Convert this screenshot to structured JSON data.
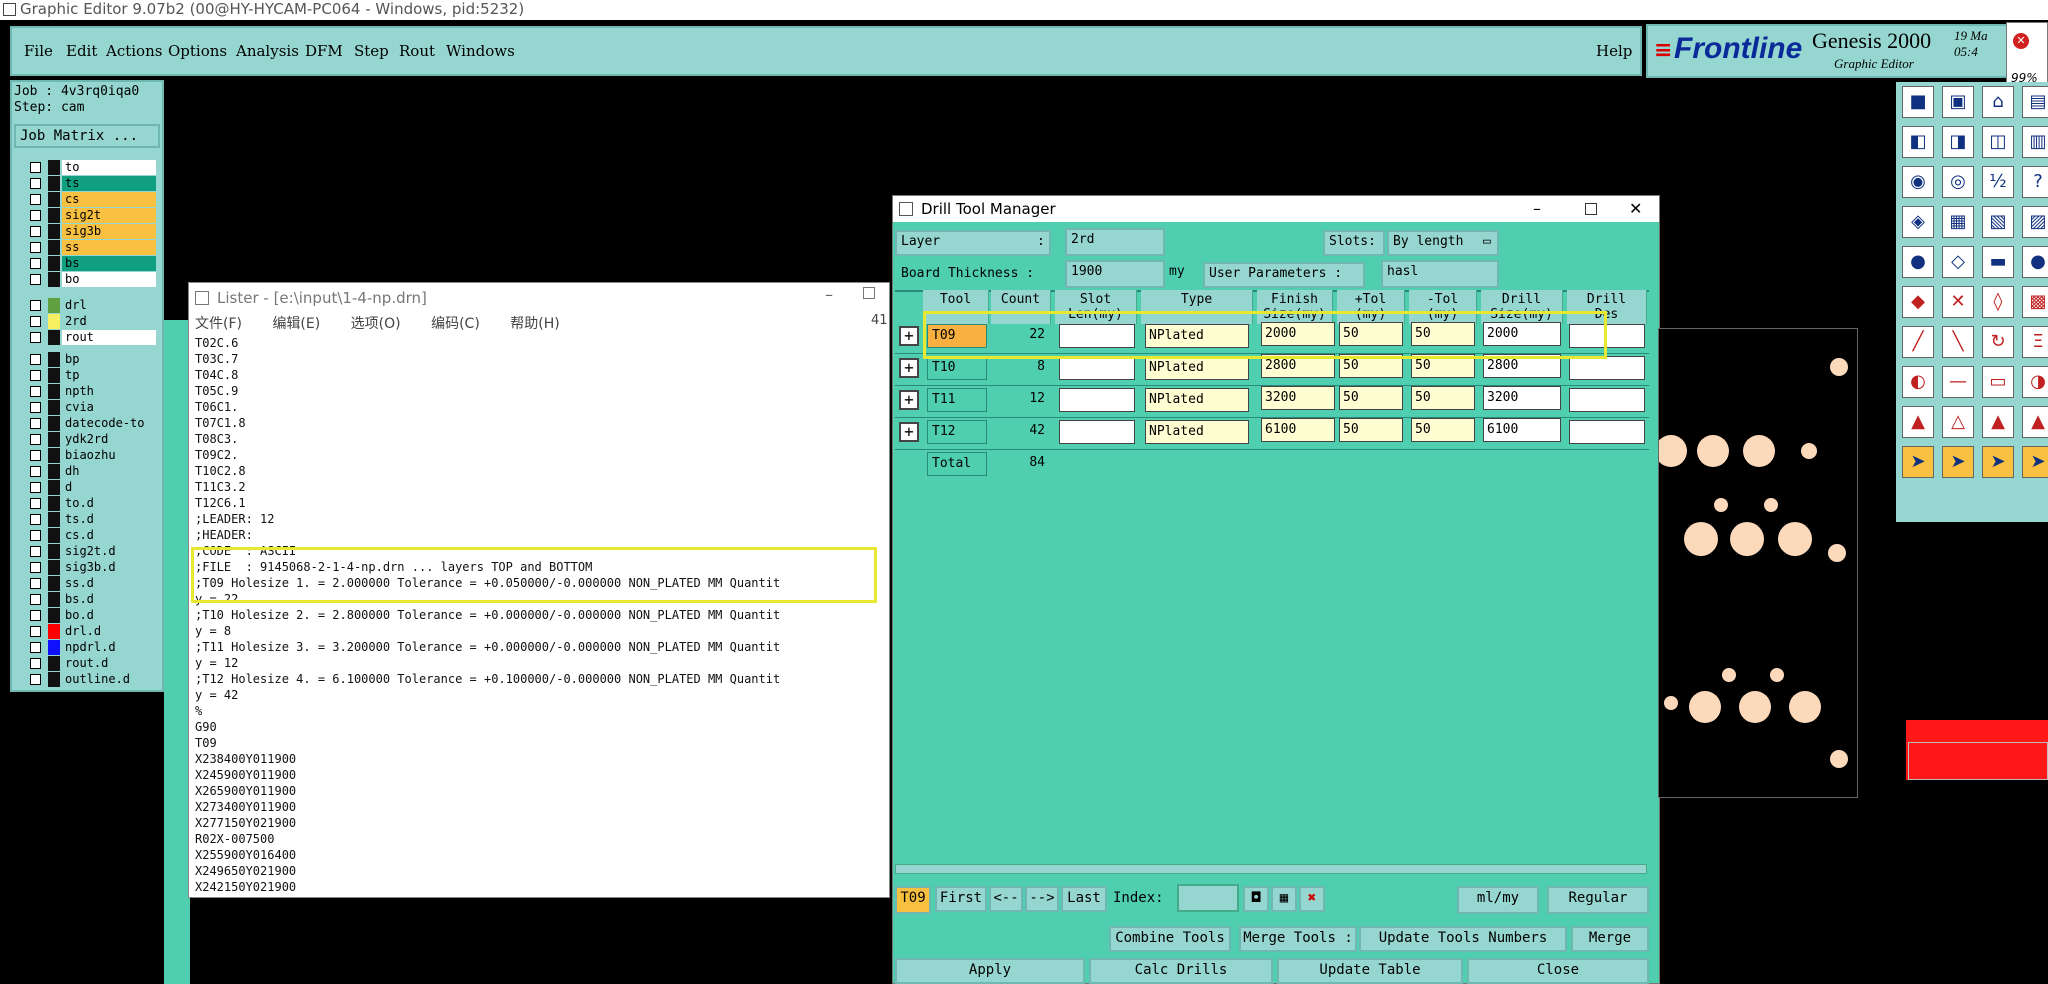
{
  "window": {
    "title": "Graphic Editor 9.07b2 (00@HY-HYCAM-PC064 - Windows, pid:5232)"
  },
  "menu": {
    "items": [
      "File",
      "Edit",
      "Actions",
      "Options",
      "Analysis",
      "DFM",
      "Step",
      "Rout",
      "Windows"
    ],
    "help": "Help"
  },
  "brand": {
    "logo": "Frontline",
    "product": "Genesis 2000",
    "subtitle": "Graphic Editor",
    "date": "19 Ma",
    "time": "05:4",
    "percent": "99%"
  },
  "job": {
    "job_label": "Job : 4v3rq0iqa0",
    "step_label": "Step: cam",
    "matrix_button": "Job Matrix ..."
  },
  "layers": [
    {
      "name": "to",
      "bg": "#ffffff"
    },
    {
      "name": "ts",
      "bg": "#10a080"
    },
    {
      "name": "cs",
      "bg": "#f8c040"
    },
    {
      "name": "sig2t",
      "bg": "#f8c040"
    },
    {
      "name": "sig3b",
      "bg": "#f8c040"
    },
    {
      "name": "ss",
      "bg": "#f8c040"
    },
    {
      "name": "bs",
      "bg": "#10a080"
    },
    {
      "name": "bo",
      "bg": "#ffffff"
    },
    {
      "name": "drl",
      "bg": "#96d6d0",
      "swatch": "#60a040"
    },
    {
      "name": "2rd",
      "bg": "#96d6d0",
      "swatch": "#f8f060"
    },
    {
      "name": "rout",
      "bg": "#ffffff"
    },
    {
      "name": "bp",
      "bg": "#96d6d0"
    },
    {
      "name": "tp",
      "bg": "#96d6d0"
    },
    {
      "name": "npth",
      "bg": "#96d6d0"
    },
    {
      "name": "cvia",
      "bg": "#96d6d0"
    },
    {
      "name": "datecode-to",
      "bg": "#96d6d0"
    },
    {
      "name": "ydk2rd",
      "bg": "#96d6d0"
    },
    {
      "name": "biaozhu",
      "bg": "#96d6d0"
    },
    {
      "name": "dh",
      "bg": "#96d6d0"
    },
    {
      "name": "d",
      "bg": "#96d6d0"
    },
    {
      "name": "to.d",
      "bg": "#96d6d0"
    },
    {
      "name": "ts.d",
      "bg": "#96d6d0"
    },
    {
      "name": "cs.d",
      "bg": "#96d6d0"
    },
    {
      "name": "sig2t.d",
      "bg": "#96d6d0"
    },
    {
      "name": "sig3b.d",
      "bg": "#96d6d0"
    },
    {
      "name": "ss.d",
      "bg": "#96d6d0"
    },
    {
      "name": "bs.d",
      "bg": "#96d6d0"
    },
    {
      "name": "bo.d",
      "bg": "#96d6d0"
    },
    {
      "name": "drl.d",
      "bg": "#96d6d0",
      "swatch": "#ff0000"
    },
    {
      "name": "npdrl.d",
      "bg": "#96d6d0",
      "swatch": "#1010ff"
    },
    {
      "name": "rout.d",
      "bg": "#96d6d0"
    },
    {
      "name": "outline.d",
      "bg": "#96d6d0"
    }
  ],
  "lister": {
    "title": "Lister - [e:\\input\\1-4-np.drn]",
    "menu": [
      "文件(F)",
      "编辑(E)",
      "选项(O)",
      "编码(C)",
      "帮助(H)"
    ],
    "scroll_count": "41",
    "lines": [
      "T02C.6",
      "T03C.7",
      "T04C.8",
      "T05C.9",
      "T06C1.",
      "T07C1.8",
      "T08C3.",
      "T09C2.",
      "T10C2.8",
      "T11C3.2",
      "T12C6.1",
      ";LEADER: 12",
      ";HEADER:",
      ";CODE  : ASCII",
      ";FILE  : 9145068-2-1-4-np.drn ... layers TOP and BOTTOM",
      ";T09 Holesize 1. = 2.000000 Tolerance = +0.050000/-0.000000 NON_PLATED MM Quantit",
      "y = 22",
      ";T10 Holesize 2. = 2.800000 Tolerance = +0.000000/-0.000000 NON_PLATED MM Quantit",
      "y = 8",
      ";T11 Holesize 3. = 3.200000 Tolerance = +0.000000/-0.000000 NON_PLATED MM Quantit",
      "y = 12",
      ";T12 Holesize 4. = 6.100000 Tolerance = +0.100000/-0.000000 NON_PLATED MM Quantit",
      "y = 42",
      "%",
      "G90",
      "T09",
      "X238400Y011900",
      "X245900Y011900",
      "X265900Y011900",
      "X273400Y011900",
      "X277150Y021900",
      "R02X-007500",
      "X255900Y016400",
      "X249650Y021900",
      "X242150Y021900"
    ]
  },
  "dtm": {
    "title": "Drill Tool Manager",
    "layer_label": "Layer",
    "layer_value": "2rd",
    "slots_label": "Slots:",
    "slots_value": "By length",
    "thickness_label": "Board Thickness :",
    "thickness_value": "1900",
    "thickness_unit": "my",
    "user_params_label": "User Parameters :",
    "user_params_value": "hasl",
    "headers": [
      "Tool",
      "Count",
      "Slot\nLen(my)",
      "Type",
      "Finish\nSize(my)",
      "+Tol\n(my)",
      "-Tol\n(my)",
      "Drill\nSize(my)",
      "Drill\nDes"
    ],
    "rows": [
      {
        "tool": "T09",
        "count": "22",
        "type": "NPlated",
        "finish": "2000",
        "ptol": "50",
        "mtol": "50",
        "drill": "2000"
      },
      {
        "tool": "T10",
        "count": "8",
        "type": "NPlated",
        "finish": "2800",
        "ptol": "50",
        "mtol": "50",
        "drill": "2800"
      },
      {
        "tool": "T11",
        "count": "12",
        "type": "NPlated",
        "finish": "3200",
        "ptol": "50",
        "mtol": "50",
        "drill": "3200"
      },
      {
        "tool": "T12",
        "count": "42",
        "type": "NPlated",
        "finish": "6100",
        "ptol": "50",
        "mtol": "50",
        "drill": "6100"
      }
    ],
    "total_label": "Total",
    "total_count": "84",
    "current_tool": "T09",
    "nav": {
      "first": "First",
      "prev": "<--",
      "next": "-->",
      "last": "Last",
      "index_label": "Index:"
    },
    "units": "ml/my",
    "mode": "Regular",
    "combine": "Combine Tools",
    "merge_tools": "Merge Tools :",
    "update_numbers": "Update Tools Numbers",
    "merge": "Merge",
    "apply": "Apply",
    "calc": "Calc Drills",
    "update_table": "Update Table",
    "close": "Close"
  },
  "colors": {
    "panel": "#96d6d0",
    "dialog": "#4fcfb0",
    "highlight": "#f0f030",
    "tool_orange": "#f8b040"
  }
}
